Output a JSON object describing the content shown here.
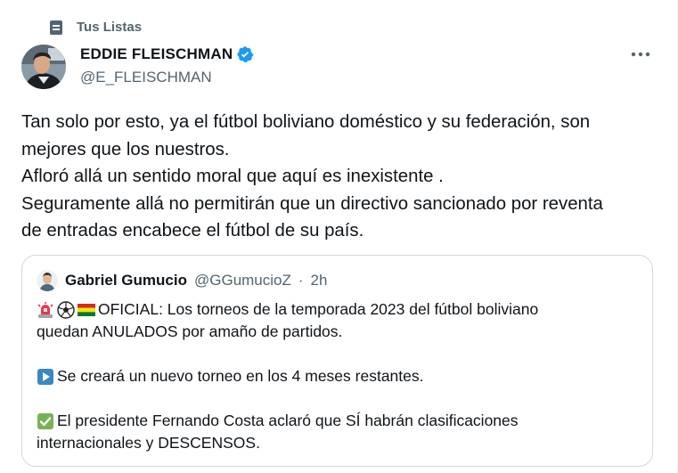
{
  "social_context": {
    "label": "Tus Listas",
    "icon": "list-icon"
  },
  "author": {
    "name": "EDDIE FLEISCHMAN",
    "handle": "@E_FLEISCHMAN",
    "verified": true,
    "verified_color": "#1d9bf0"
  },
  "tweet": {
    "lines": [
      "Tan solo por esto, ya el fútbol boliviano doméstico y su federación, son",
      "mejores que los nuestros.",
      "Afloró allá un sentido moral que aquí es inexistente .",
      "Seguramente allá no permitirán que un directivo sancionado por reventa",
      "de entradas encabece el fútbol de su país."
    ]
  },
  "quote": {
    "name": "Gabriel Gumucio",
    "handle": "@GGumucioZ",
    "separator": "·",
    "time": "2h",
    "lines": [
      {
        "emojis": [
          "siren-emoji",
          "soccer-ball-emoji",
          "bolivia-flag-emoji"
        ],
        "text": "OFICIAL: Los torneos de la temporada 2023 del fútbol boliviano"
      },
      {
        "text": "quedan ANULADOS por amaño de partidos."
      },
      {
        "gap": true
      },
      {
        "emojis": [
          "play-button-emoji"
        ],
        "text": "Se creará un nuevo torneo en los 4 meses restantes."
      },
      {
        "gap": true
      },
      {
        "emojis": [
          "check-mark-emoji"
        ],
        "text": "El presidente Fernando Costa aclaró que SÍ habrán clasificaciones"
      },
      {
        "text": "internacionales y DESCENSOS."
      }
    ]
  },
  "colors": {
    "text_primary": "#0f1419",
    "text_secondary": "#536471",
    "border": "#cfd9de"
  }
}
